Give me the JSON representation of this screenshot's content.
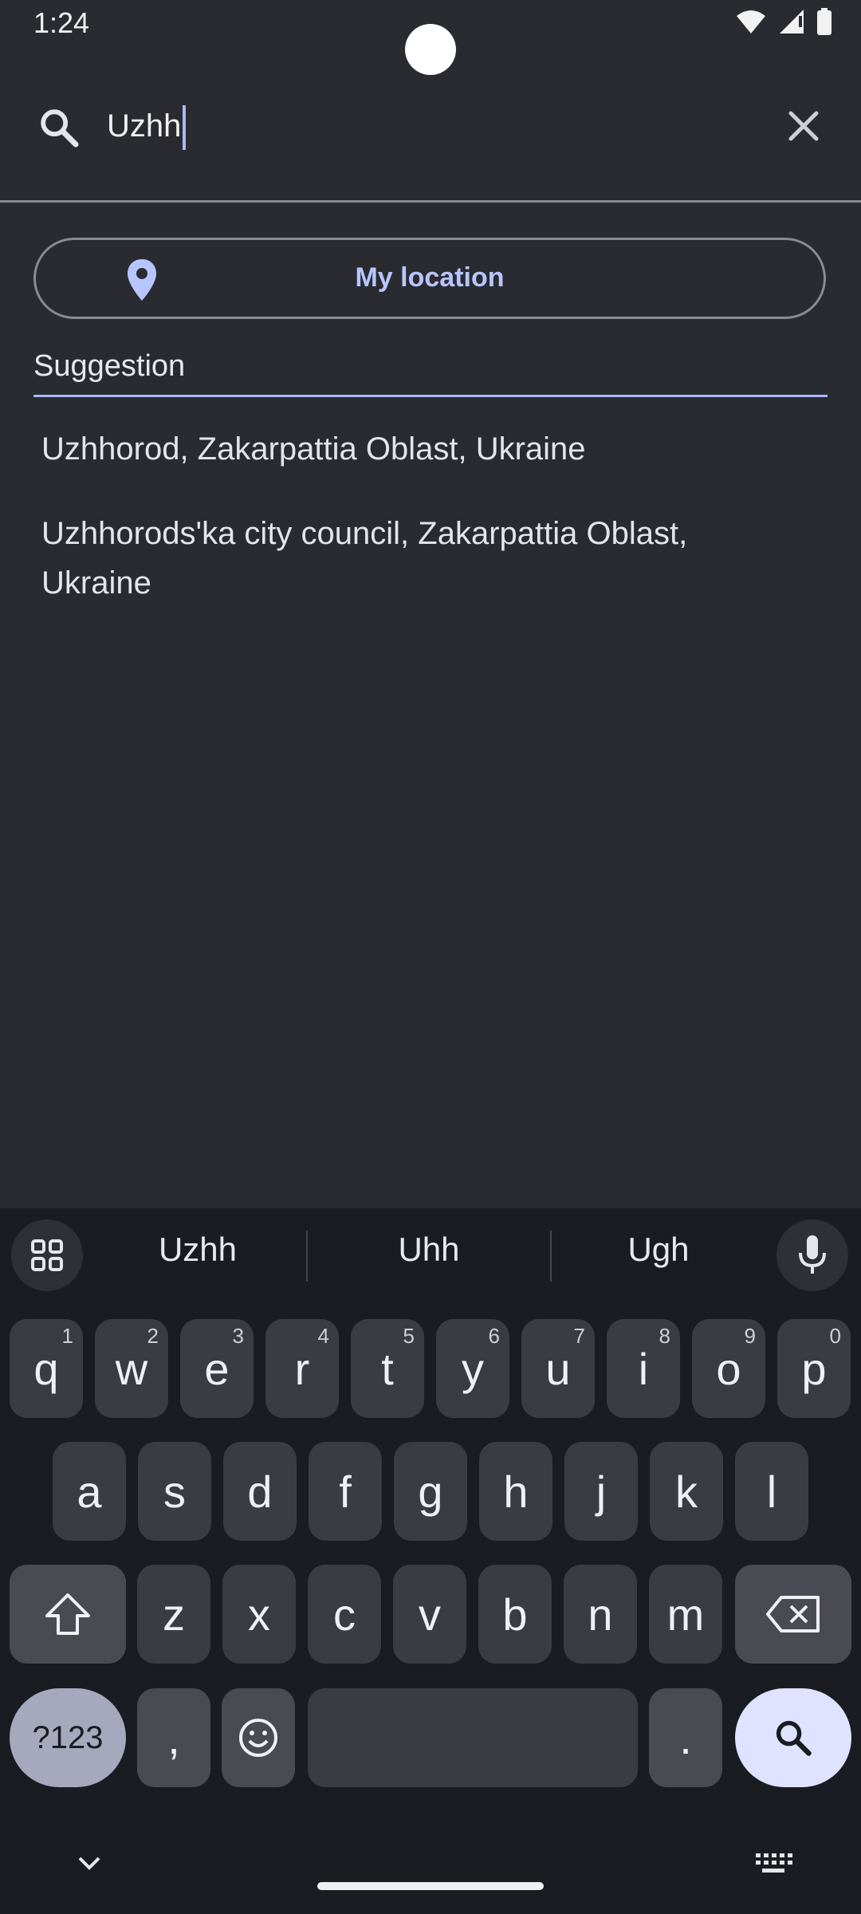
{
  "status": {
    "time": "1:24"
  },
  "search": {
    "query": "Uzhh"
  },
  "my_location": {
    "label": "My location"
  },
  "suggestions": {
    "header": "Suggestion",
    "items": [
      {
        "line1": "Uzhhorod, Zakarpattia Oblast, Ukraine",
        "line2": ""
      },
      {
        "line1": "Uzhhorods'ka city council, Zakarpattia Oblast,",
        "line2": "Ukraine"
      }
    ]
  },
  "keyboard": {
    "suggestions": [
      "Uzhh",
      "Uhh",
      "Ugh"
    ],
    "row1": [
      {
        "k": "q",
        "h": "1"
      },
      {
        "k": "w",
        "h": "2"
      },
      {
        "k": "e",
        "h": "3"
      },
      {
        "k": "r",
        "h": "4"
      },
      {
        "k": "t",
        "h": "5"
      },
      {
        "k": "y",
        "h": "6"
      },
      {
        "k": "u",
        "h": "7"
      },
      {
        "k": "i",
        "h": "8"
      },
      {
        "k": "o",
        "h": "9"
      },
      {
        "k": "p",
        "h": "0"
      }
    ],
    "row2": [
      "a",
      "s",
      "d",
      "f",
      "g",
      "h",
      "j",
      "k",
      "l"
    ],
    "row3": [
      "z",
      "x",
      "c",
      "v",
      "b",
      "n",
      "m"
    ],
    "symbols_label": "?123",
    "comma": ",",
    "period": "."
  },
  "colors": {
    "background": "#2a2b31",
    "accent": "#a9b8ff",
    "keyboard_bg": "#1b1c21"
  }
}
